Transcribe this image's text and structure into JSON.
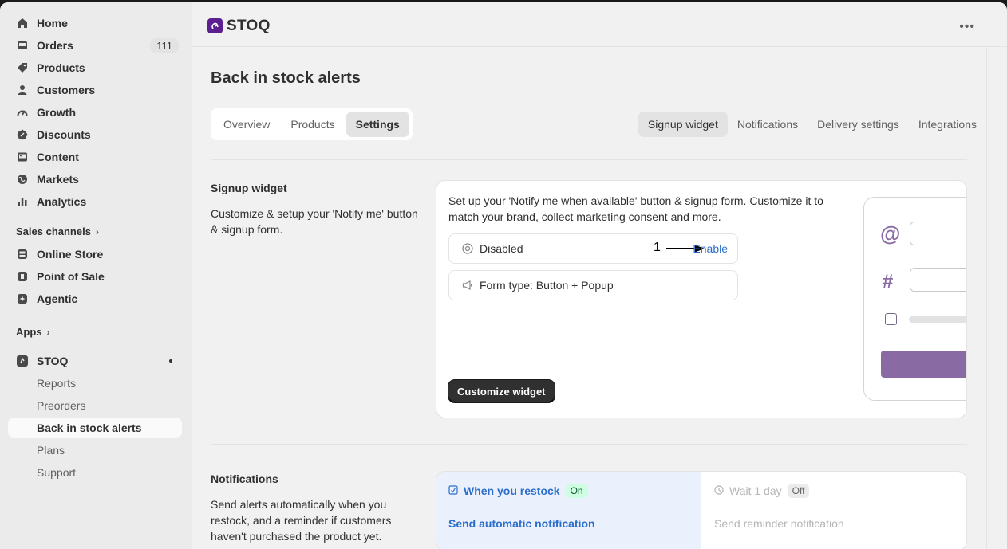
{
  "sidebar": {
    "nav": [
      {
        "label": "Home",
        "icon": "home-icon"
      },
      {
        "label": "Orders",
        "icon": "orders-icon",
        "badge": "111"
      },
      {
        "label": "Products",
        "icon": "tag-icon"
      },
      {
        "label": "Customers",
        "icon": "person-icon"
      },
      {
        "label": "Growth",
        "icon": "gauge-icon"
      },
      {
        "label": "Discounts",
        "icon": "discount-icon"
      },
      {
        "label": "Content",
        "icon": "image-icon"
      },
      {
        "label": "Markets",
        "icon": "globe-icon"
      },
      {
        "label": "Analytics",
        "icon": "bar-chart-icon"
      }
    ],
    "sales_channels_label": "Sales channels",
    "channels": [
      {
        "label": "Online Store",
        "icon": "store-icon"
      },
      {
        "label": "Point of Sale",
        "icon": "pos-icon"
      },
      {
        "label": "Agentic",
        "icon": "agentic-icon"
      }
    ],
    "apps_label": "Apps",
    "app": {
      "label": "STOQ",
      "icon": "stoq-logo-icon"
    },
    "app_items": [
      "Reports",
      "Preorders",
      "Back in stock alerts",
      "Plans",
      "Support"
    ],
    "active_app_item": "Back in stock alerts"
  },
  "header": {
    "app_name": "STOQ",
    "more_label": "•••"
  },
  "page": {
    "title": "Back in stock alerts",
    "tabs": [
      "Overview",
      "Products",
      "Settings"
    ],
    "active_tab": "Settings",
    "subtabs": [
      "Signup widget",
      "Notifications",
      "Delivery settings",
      "Integrations"
    ],
    "active_subtab": "Signup widget"
  },
  "signup_section": {
    "title": "Signup widget",
    "description": "Customize & setup your 'Notify me' button & signup form.",
    "intro": "Set up your 'Notify me when available' button & signup form. Customize it to match your brand, collect marketing consent and more.",
    "status_label": "Disabled",
    "annotation_number": "1",
    "enable_label": "Enable",
    "form_type_label": "Form type: Button + Popup",
    "customize_button": "Customize widget",
    "preview_at": "@",
    "preview_hash": "#"
  },
  "notifications_section": {
    "title": "Notifications",
    "description": "Send alerts automatically when you restock, and a reminder if customers haven't purchased the product yet.",
    "restock": {
      "title": "When you restock",
      "status": "On",
      "link": "Send automatic notification"
    },
    "wait": {
      "title": "Wait 1 day",
      "status": "Off",
      "link": "Send reminder notification"
    }
  },
  "colors": {
    "accent": "#2c6ecb",
    "brand": "#5b1f8f",
    "preview_purple": "#8a6aa3",
    "on_badge": "#cdfee1"
  }
}
